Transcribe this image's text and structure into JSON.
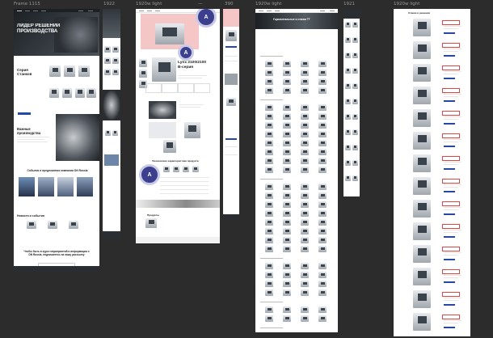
{
  "canvas": {
    "background": "#2c2c2c"
  },
  "frames": [
    {
      "id": "f1",
      "label": "Frame 1115"
    },
    {
      "id": "f2",
      "label": "1922"
    },
    {
      "id": "f3",
      "label": "1920w light"
    },
    {
      "id": "f4",
      "label": "—"
    },
    {
      "id": "f5",
      "label": "390"
    },
    {
      "id": "f6",
      "label": "1920w light"
    },
    {
      "id": "f7",
      "label": "1921"
    },
    {
      "id": "f8",
      "label": "1920w light"
    }
  ],
  "f1": {
    "hero_title": "ЛИДЕР РЕШЕНИЙ ПРОИЗВОДСТВА",
    "section_series": "Серия Станков",
    "section_parts": "Важные производства",
    "section_events": "События и предложения компании DN Russia",
    "section_news": "Новости и события",
    "cta_text": "Чтобы быть в курсе мероприятий и информации о DN Russia, подпишитесь на нашу рассылку"
  },
  "f3": {
    "product_title": "Lynx 2100/2100 B-серия",
    "avatar_letter": "A",
    "section_related": "Продукты",
    "section_table": "Технические характеристики продукта"
  },
  "f6": {
    "page_title": "Горизонтальные и станки TT"
  },
  "f8": {
    "breadcrumb": "Станки и решения"
  },
  "colors": {
    "accent": "#2548a8",
    "badge": "#3b3f8e",
    "hero_pink": "#f4c6c6"
  }
}
